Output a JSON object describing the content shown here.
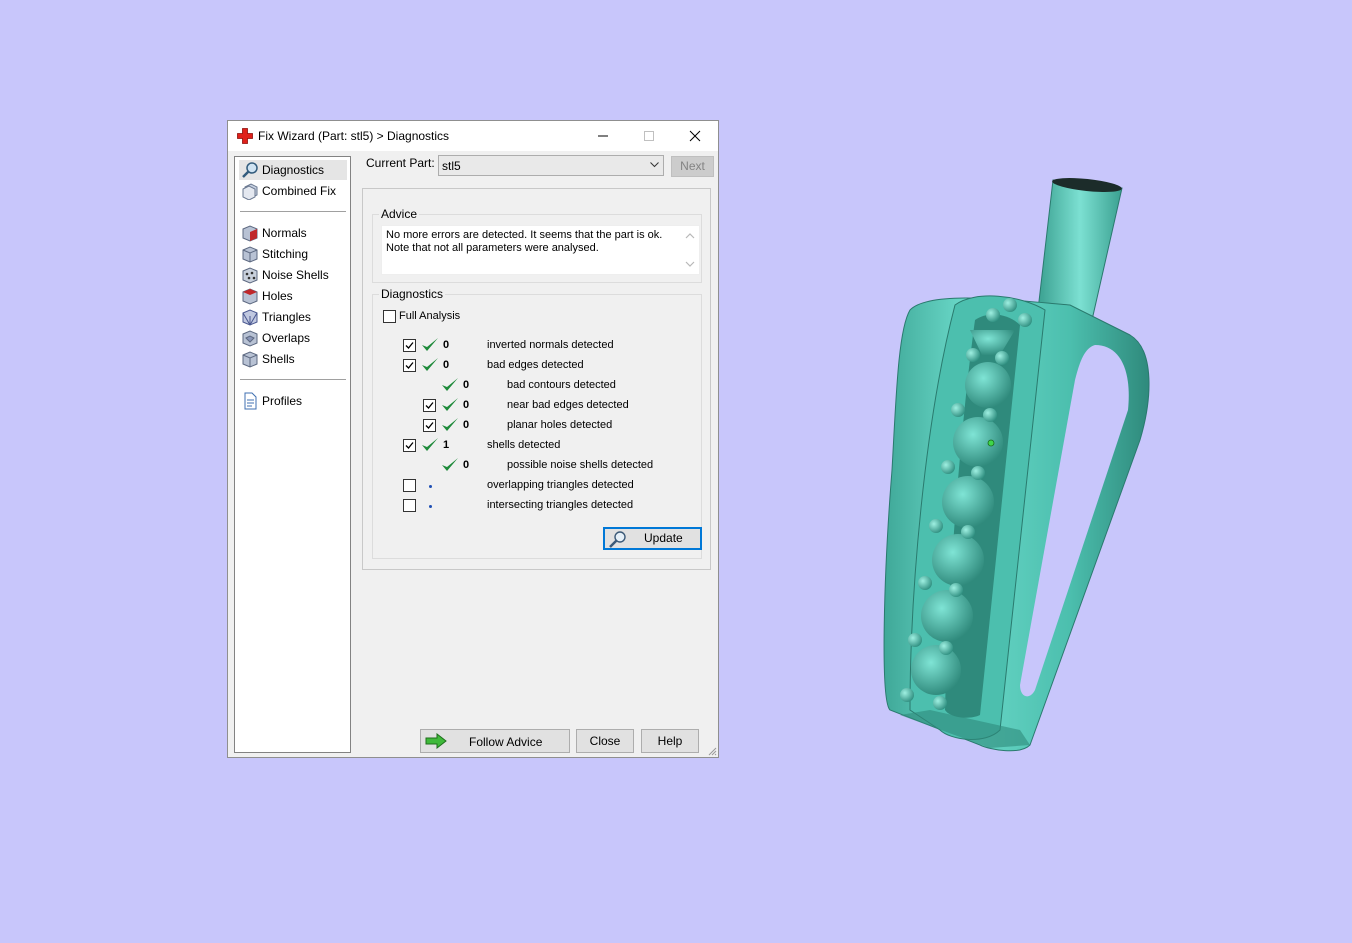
{
  "window": {
    "title": "Fix Wizard (Part: stl5) > Diagnostics",
    "controls": [
      "minimize-icon",
      "maximize-icon",
      "close-icon"
    ]
  },
  "sidebar": {
    "groups": [
      [
        {
          "label": "Diagnostics",
          "icon": "magnifier-icon",
          "selected": true
        },
        {
          "label": "Combined Fix",
          "icon": "combined-fix-icon"
        }
      ],
      [
        {
          "label": "Normals",
          "icon": "normals-icon"
        },
        {
          "label": "Stitching",
          "icon": "stitching-icon"
        },
        {
          "label": "Noise Shells",
          "icon": "noise-shells-icon"
        },
        {
          "label": "Holes",
          "icon": "holes-icon"
        },
        {
          "label": "Triangles",
          "icon": "triangles-icon"
        },
        {
          "label": "Overlaps",
          "icon": "overlaps-icon"
        },
        {
          "label": "Shells",
          "icon": "shells-icon"
        }
      ],
      [
        {
          "label": "Profiles",
          "icon": "profiles-icon"
        }
      ]
    ]
  },
  "current_part": {
    "label": "Current Part:",
    "value": "stl5"
  },
  "next_button": "Next",
  "advice": {
    "legend": "Advice",
    "text": "No more errors are detected. It seems that the part is ok. Note that not all parameters were analysed."
  },
  "diagnostics": {
    "legend": "Diagnostics",
    "full_analysis": {
      "label": "Full Analysis",
      "checked": false
    },
    "rows": [
      {
        "checkbox": true,
        "checked": true,
        "status": "ok",
        "count": "0",
        "label": "inverted normals detected",
        "level": 0
      },
      {
        "checkbox": true,
        "checked": true,
        "status": "ok",
        "count": "0",
        "label": "bad edges detected",
        "level": 0
      },
      {
        "checkbox": false,
        "status": "ok",
        "count": "0",
        "label": "bad contours detected",
        "level": 1
      },
      {
        "checkbox": true,
        "checked": true,
        "status": "ok",
        "count": "0",
        "label": "near bad edges detected",
        "level": 1
      },
      {
        "checkbox": true,
        "checked": true,
        "status": "ok",
        "count": "0",
        "label": "planar holes detected",
        "level": 1
      },
      {
        "checkbox": true,
        "checked": true,
        "status": "ok",
        "count": "1",
        "label": "shells detected",
        "level": 0
      },
      {
        "checkbox": false,
        "status": "ok",
        "count": "0",
        "label": "possible noise shells detected",
        "level": 1
      },
      {
        "checkbox": true,
        "checked": false,
        "status": "unknown",
        "count": "",
        "label": "overlapping triangles detected",
        "level": 0
      },
      {
        "checkbox": true,
        "checked": false,
        "status": "unknown",
        "count": "",
        "label": "intersecting triangles detected",
        "level": 0
      }
    ],
    "update_button": "Update"
  },
  "footer": {
    "follow_advice": "Follow Advice",
    "close": "Close",
    "help": "Help"
  },
  "colors": {
    "desktop": "#c8c6fb",
    "model": "#5fd0be",
    "check_ok": "#1e8a3a",
    "dot": "#1f4fb4"
  }
}
